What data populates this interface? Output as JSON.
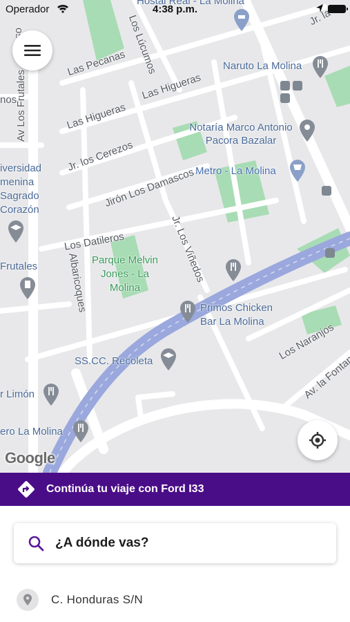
{
  "status_bar": {
    "carrier": "Operador",
    "time": "4:38 p.m."
  },
  "map": {
    "labels": {
      "av_los_frutales": "Av Los Frutales",
      "los_pecanas": "Las Pecanas",
      "los_lucumos": "Los Lúcumos",
      "las_higueras_1": "Las Higueras",
      "las_higueras_2": "Las Higueras",
      "jr_los_cerezos": "Jr. los Cerezos",
      "jiron_los_damascos": "Jirón Los Damascos",
      "los_datileros": "Los Datileros",
      "albaricoques": "Albaricoques",
      "jr_los_vinedos": "Jr. Los Viñedos",
      "los_naranjos": "Los Naranjos",
      "av_la_fontana": "Av. la Fontana",
      "jr_la": "Jr. la",
      "hostal": "Hostal Real - La Molina",
      "naruto": "Naruto La Molina",
      "notaria": "Notaría Marco Antonio Pacora Bazalar",
      "metro": "Metro - La Molina",
      "parque": "Parque Melvin Jones - La Molina",
      "primos": "Primos Chicken Bar La Molina",
      "recoleta": "SS.CC. Recoleta",
      "universidad": "iversidad menina Sagrado Corazón",
      "frutales": "Frutales",
      "limon": "r Limón",
      "ero_la_molina": "ero La Molina",
      "nos": "nos",
      "los_f": "os F"
    },
    "google_logo": "Google"
  },
  "banner": {
    "label": "Continúa tu viaje con Ford I33",
    "color": "#4a0d88"
  },
  "search": {
    "placeholder": "¿A dónde vas?"
  },
  "recent": {
    "address": "C. Honduras S/N"
  },
  "colors": {
    "accent": "#4a0d88",
    "highway": "#9aa8dd",
    "park": "#a8dcb4",
    "map_bg": "#e8e8ea"
  }
}
